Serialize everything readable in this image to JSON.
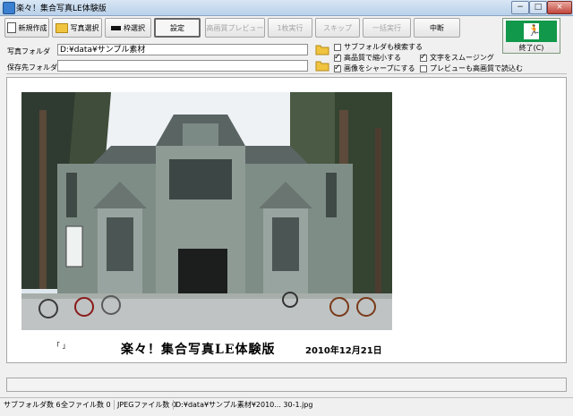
{
  "window": {
    "title": "楽々！集合写真LE体験版"
  },
  "system_buttons": {
    "minimize": "−",
    "maximize": "□",
    "close": "×"
  },
  "toolbar": {
    "new": "新規作成",
    "select_photo": "写真選択",
    "frame_select": "枠選択",
    "settings": "設定",
    "hq_preview": "高画質プレビュー",
    "run_one": "1枚実行",
    "skip": "スキップ",
    "batch_run": "一括実行",
    "stop": "中断",
    "exit": "終了(C)"
  },
  "folders": {
    "photo_label": "写真フォルダ",
    "photo_value": "D:¥data¥サンプル素材",
    "save_label": "保存先フォルダ",
    "save_value": ""
  },
  "options": {
    "search_subfolders": {
      "label": "サブフォルダも検索する",
      "checked": false
    },
    "hq_shrink": {
      "label": "高品質で縮小する",
      "checked": true
    },
    "sharpen": {
      "label": "画像をシャープにする",
      "checked": true
    },
    "smooth_text": {
      "label": "文字をスムージング",
      "checked": true
    },
    "preview_hq": {
      "label": "プレビューも高画質で読込む",
      "checked": false
    }
  },
  "preview": {
    "quote_marks": "「 」",
    "caption": "楽々！集合写真LE体験版",
    "date": "2010年12月21日"
  },
  "status": {
    "subfolders": "サブフォルダ数 6",
    "all_files": "全ファイル数 0",
    "jpeg_files": "JPEGファイル数 0",
    "path": "D:¥data¥サンプル素材¥2010... 30-1.jpg"
  },
  "colors": {
    "accent_exit": "#11984a",
    "titlebar": "#c5dbf1"
  }
}
